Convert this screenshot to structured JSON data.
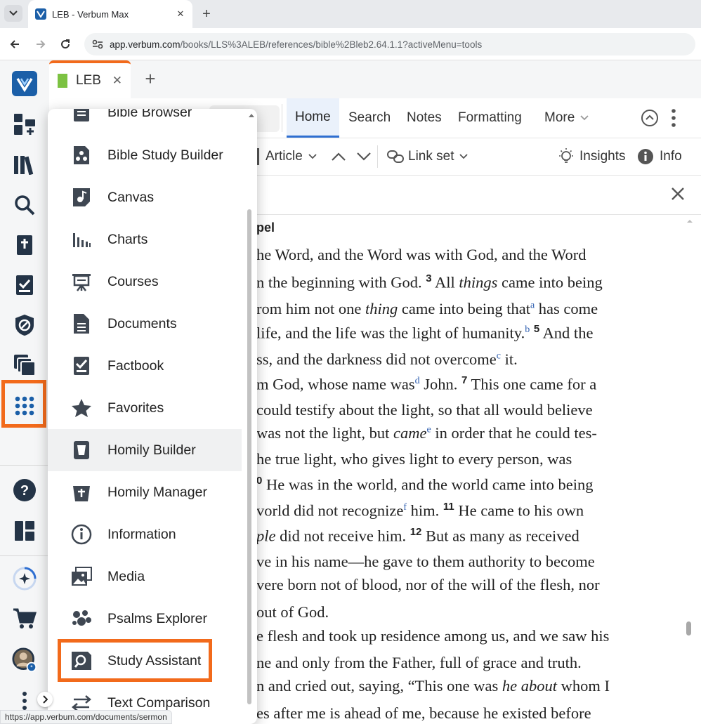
{
  "browser": {
    "tab_title": "LEB - Verbum Max",
    "url_host": "app.verbum.com",
    "url_path": "/books/LLS%3ALEB/references/bible%2Bleb2.64.1.1?activeMenu=tools",
    "status_url": "https://app.verbum.com/documents/sermon"
  },
  "app_tab": {
    "label": "LEB"
  },
  "panel_menu": {
    "tabs": [
      "Home",
      "Search",
      "Notes",
      "Formatting",
      "More"
    ]
  },
  "toolbar": {
    "article": "Article",
    "link_set": "Link set",
    "insights": "Insights",
    "info": "Info"
  },
  "tools_menu": {
    "items": [
      {
        "label": "Bible Browser",
        "icon": "list-icon"
      },
      {
        "label": "Bible Study Builder",
        "icon": "study-builder-icon"
      },
      {
        "label": "Canvas",
        "icon": "canvas-icon"
      },
      {
        "label": "Charts",
        "icon": "charts-icon"
      },
      {
        "label": "Courses",
        "icon": "courses-icon"
      },
      {
        "label": "Documents",
        "icon": "document-icon"
      },
      {
        "label": "Factbook",
        "icon": "factbook-icon"
      },
      {
        "label": "Favorites",
        "icon": "star-icon"
      },
      {
        "label": "Homily Builder",
        "icon": "homily-builder-icon"
      },
      {
        "label": "Homily Manager",
        "icon": "homily-manager-icon"
      },
      {
        "label": "Information",
        "icon": "info-icon"
      },
      {
        "label": "Media",
        "icon": "media-icon"
      },
      {
        "label": "Psalms Explorer",
        "icon": "psalms-icon"
      },
      {
        "label": "Study Assistant",
        "icon": "study-assistant-icon"
      },
      {
        "label": "Text Comparison",
        "icon": "compare-icon"
      }
    ]
  },
  "bible": {
    "heading": "pel",
    "lines": [
      "he Word, and the Word was with God, and the Word",
      "n the beginning with God.",
      "rom him not one",
      "life, and the life was the light of humanity.",
      "ss, and the darkness did not overcome",
      "m God,",
      " could testify about the light, so that all would believe",
      "was not the light, but",
      "he true light, who gives light to every person, was",
      "He was in the world, and the world came into being",
      "vorld did not recognize",
      "did not receive him.",
      "ve in his name—he gave to them authority to become",
      "vere born not of blood, nor of the will of the flesh, nor",
      "out of God.",
      "e flesh and took up residence among us, and we saw his",
      "ne and only from the Father, full of grace and truth.",
      "n and cried out, saying, “This one was",
      "es after me is ahead of me, because he existed before"
    ],
    "frag": {
      "v3": "3",
      "all": "All",
      "things": "things",
      "came_into_being": "came into being",
      "thing": "thing",
      "came_into_being_that": "came into being that",
      "fa": "a",
      "has_come": "has come",
      "fb": "b",
      "v5": "5",
      "and_the": "And the",
      "fc": "c",
      "it": "it.",
      "whose_name_was": "whose name was",
      "fd": "d",
      "john": "John.",
      "v7": "7",
      "this_one_came": "This one came for a",
      "came": "came",
      "fe": "e",
      "in_order": "in order that he could tes-",
      "v10": "0",
      "ff": "f",
      "him": "him.",
      "v11": "11",
      "he_came": "He came to his own",
      "ple": "ple",
      "v12": "12",
      "but_as_many": "But as many as received",
      "he_about": "he about",
      "whom_i": "whom I"
    }
  },
  "colors": {
    "accent_orange": "#f26a1b",
    "brand_blue": "#1b5fa8",
    "active_tab_blue": "#2f6fd1"
  }
}
